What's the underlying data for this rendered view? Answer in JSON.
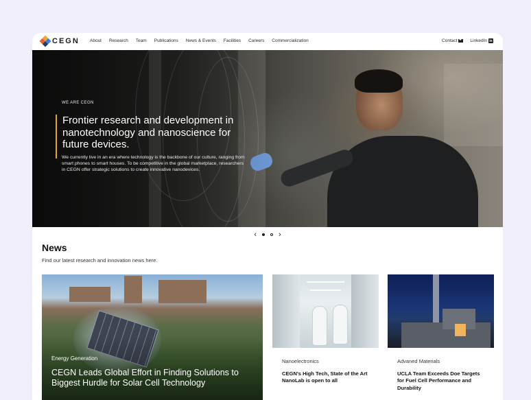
{
  "nav": {
    "logo_text": "CEGN",
    "items": [
      "About",
      "Research",
      "Team",
      "Publications",
      "News & Events",
      "Facilities",
      "Careers",
      "Commercialization"
    ],
    "contact_label": "Contact",
    "linkedin_label": "LinkedIn",
    "linkedin_glyph": "in"
  },
  "hero": {
    "eyebrow": "WE ARE CEGN",
    "title": "Frontier research and development in nanotechnology and nanoscience for future devices.",
    "body": "We currently live in an era where technology is the backbone of our culture, ranging from smart phones to smart houses. To be competitive in the global marketplace, researchers in CEGN offer strategic solutions to create innovative nanodevices.",
    "accent_color": "#e8a42c"
  },
  "carousel": {
    "prev_icon": "chevron-left-icon",
    "next_icon": "chevron-right-icon",
    "slide_count": 2,
    "active_index": 0
  },
  "news": {
    "title": "News",
    "subtitle": "Find our latest research and innovation news here.",
    "featured": {
      "tag": "Energy Generation",
      "title": "CEGN Leads Global Effort in Finding Solutions to Biggest Hurdle for Solar Cell Technology"
    },
    "cards": [
      {
        "tag": "Nanoelectronics",
        "title": "CEGN's High Tech, State of the Art NanoLab is open to all"
      },
      {
        "tag": "Advaned Materials",
        "title": "UCLA Team Exceeds Doe Targets for Fuel Cell Performance and Durability"
      }
    ]
  }
}
